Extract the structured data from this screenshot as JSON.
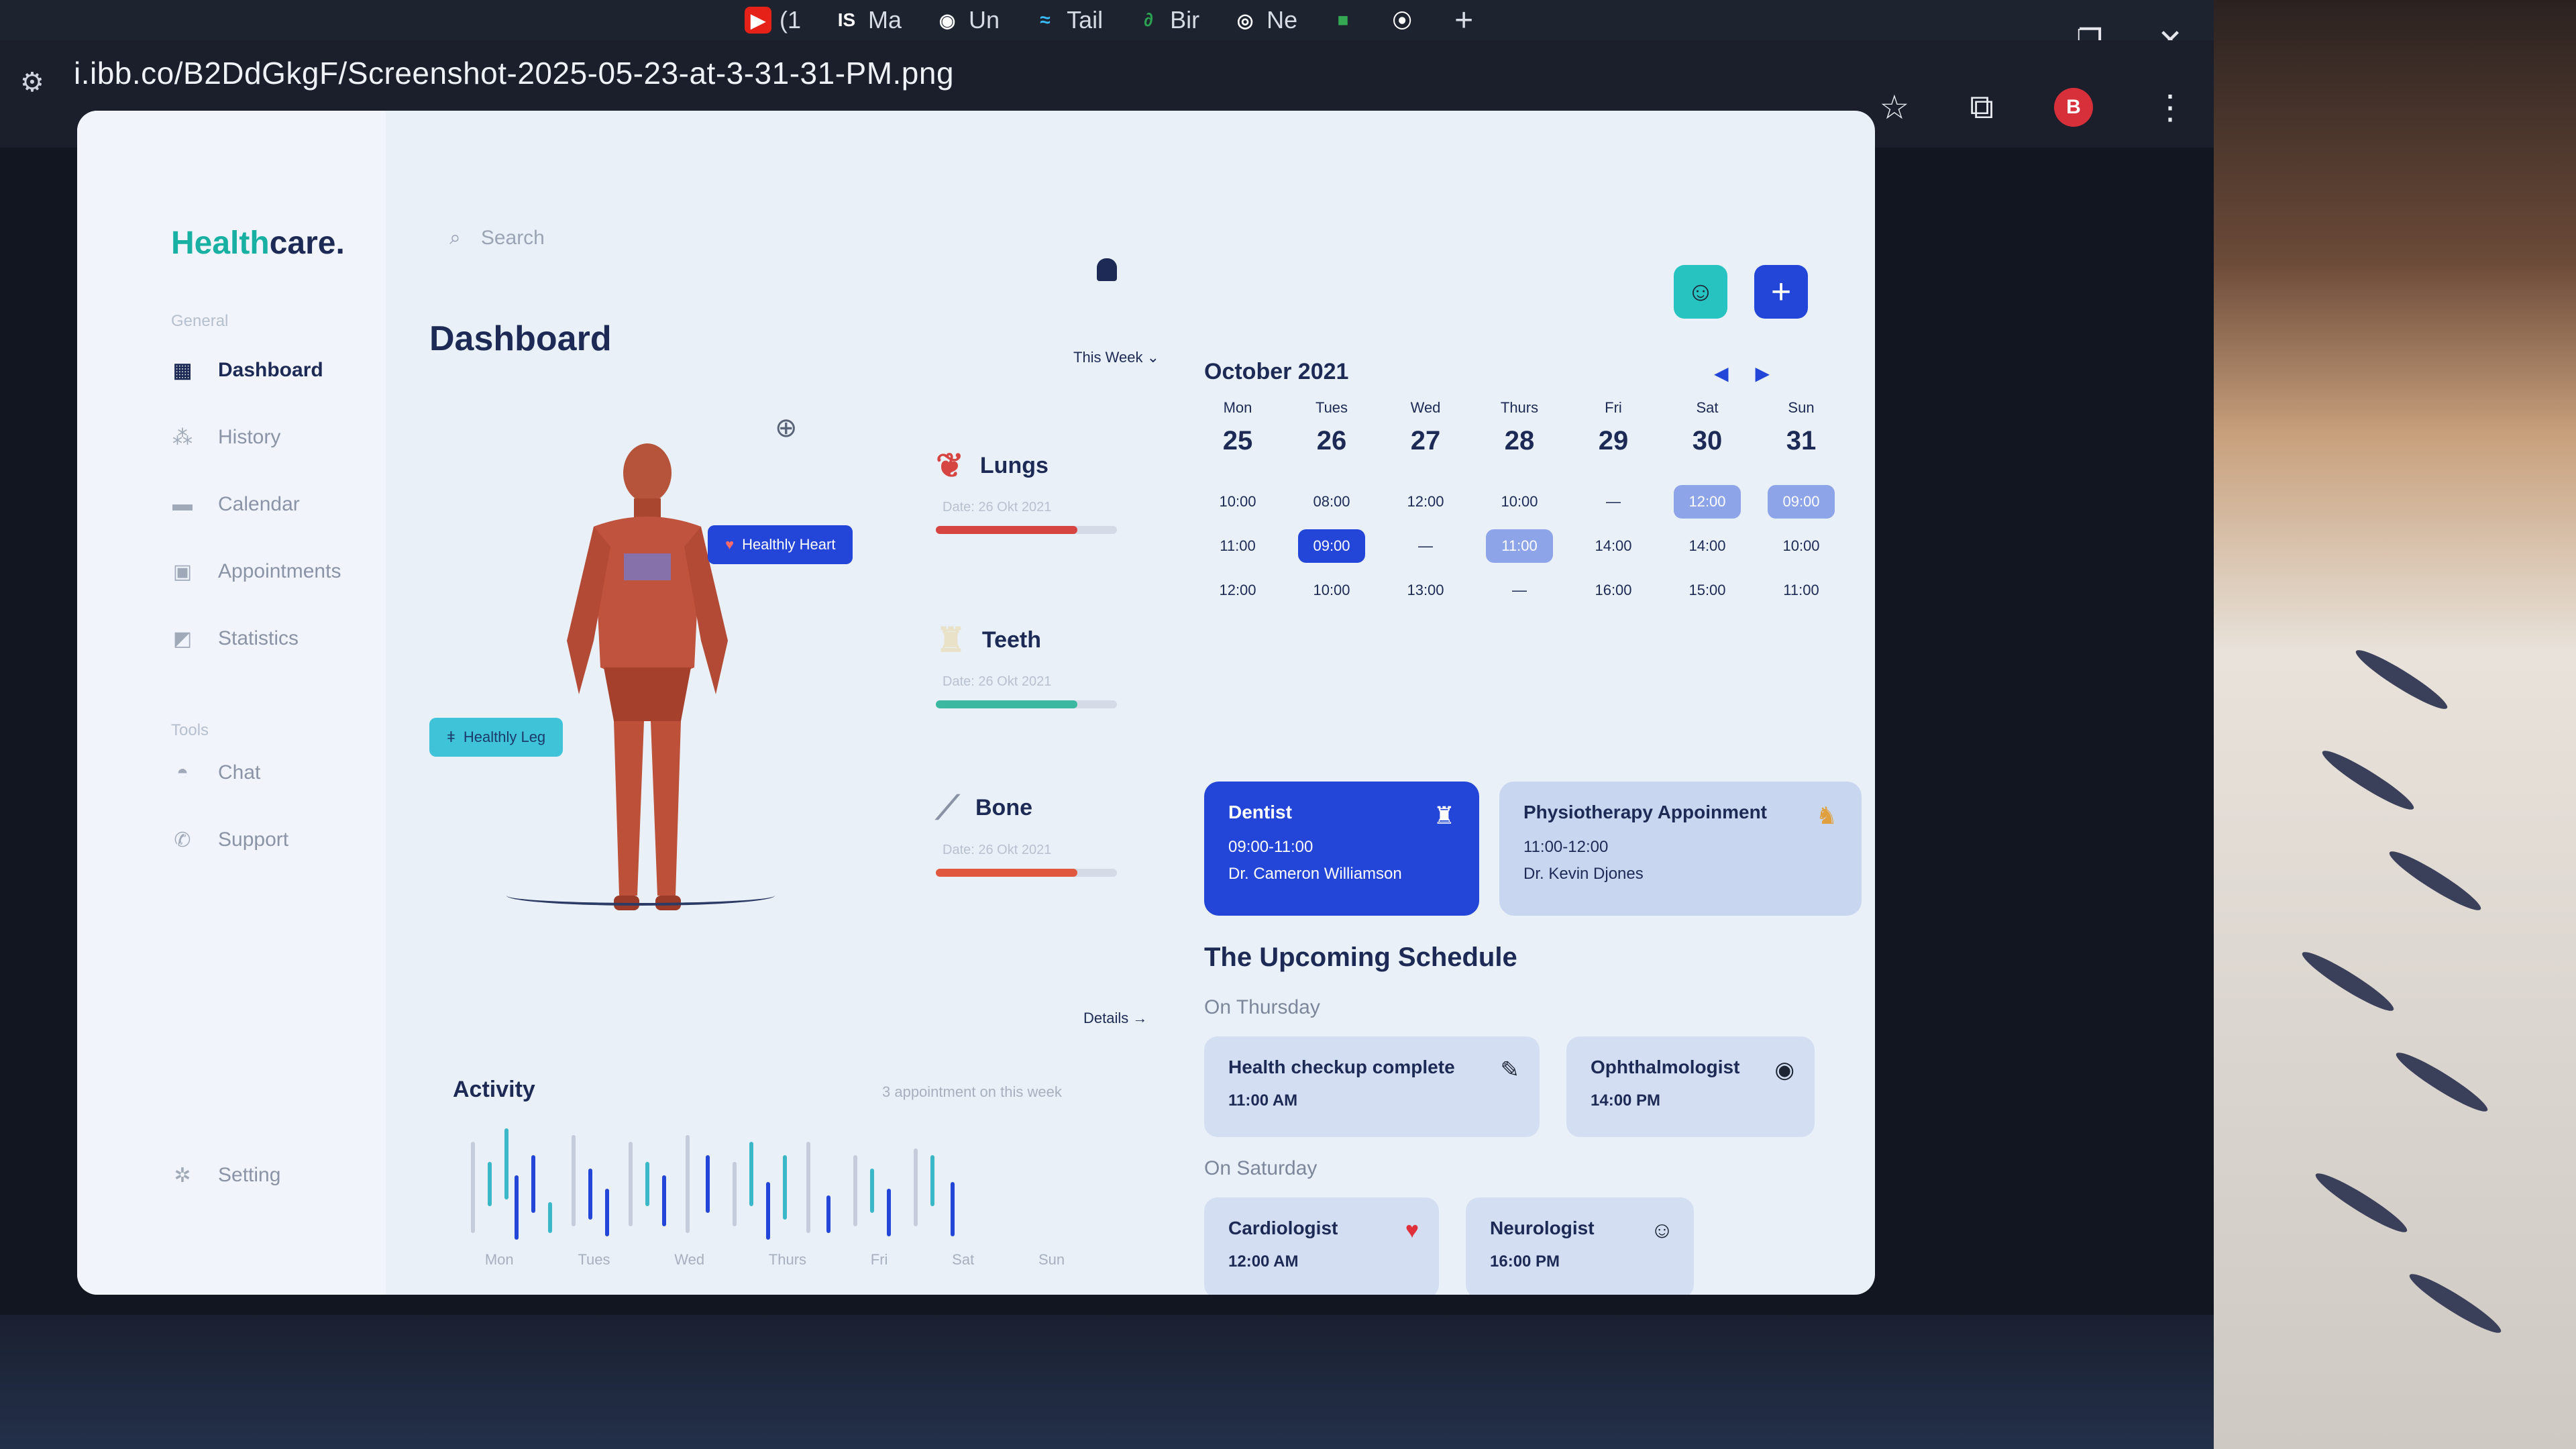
{
  "browser": {
    "tabs": [
      {
        "label": "(1",
        "icon": "youtube-icon",
        "color": "#e62117"
      },
      {
        "label": "Ma",
        "icon": "stackshare-icon",
        "color": "#222"
      },
      {
        "label": "Un",
        "icon": "github-icon",
        "color": "#222"
      },
      {
        "label": "Tail",
        "icon": "tailwind-icon",
        "color": "#38bdf8"
      },
      {
        "label": "Bir",
        "icon": "bir-icon",
        "color": "#2aa050"
      },
      {
        "label": "Ne",
        "icon": "chrome-icon",
        "color": "#888"
      }
    ],
    "url": "i.ibb.co/B2DdGkgF/Screenshot-2025-05-23-at-3-31-31-PM.png",
    "profile_initial": "B"
  },
  "app": {
    "logo_part1": "Health",
    "logo_part2": "care.",
    "section_general": "General",
    "section_tools": "Tools",
    "nav": [
      {
        "label": "Dashboard",
        "icon": "dashboard-icon",
        "active": true
      },
      {
        "label": "History",
        "icon": "history-icon"
      },
      {
        "label": "Calendar",
        "icon": "calendar-icon"
      },
      {
        "label": "Appointments",
        "icon": "appointments-icon"
      },
      {
        "label": "Statistics",
        "icon": "statistics-icon"
      }
    ],
    "tools": [
      {
        "label": "Chat",
        "icon": "chat-icon"
      },
      {
        "label": "Support",
        "icon": "phone-icon"
      }
    ],
    "setting_label": "Setting",
    "search_placeholder": "Search",
    "page_title": "Dashboard",
    "week_selector": "This Week",
    "badge_heart": "Healthly Heart",
    "badge_leg": "Healthly Leg",
    "organs": [
      {
        "name": "Lungs",
        "date": "Date: 26 Okt 2021",
        "progress": 0.78,
        "color": "#d64541"
      },
      {
        "name": "Teeth",
        "date": "Date: 26 Okt 2021",
        "progress": 0.78,
        "color": "#3bb8a0"
      },
      {
        "name": "Bone",
        "date": "Date: 26 Okt 2021",
        "progress": 0.78,
        "color": "#e0593f"
      }
    ],
    "details_link": "Details →",
    "activity_title": "Activity",
    "activity_sub": "3 appointment on this week",
    "activity_days": [
      "Mon",
      "Tues",
      "Wed",
      "Thurs",
      "Fri",
      "Sat",
      "Sun"
    ],
    "calendar": {
      "month": "October 2021",
      "days": [
        {
          "name": "Mon",
          "num": "25",
          "slots": [
            "10:00",
            "11:00",
            "12:00"
          ]
        },
        {
          "name": "Tues",
          "num": "26",
          "slots": [
            "08:00",
            "09:00",
            "10:00"
          ]
        },
        {
          "name": "Wed",
          "num": "27",
          "slots": [
            "12:00",
            "—",
            "13:00"
          ]
        },
        {
          "name": "Thurs",
          "num": "28",
          "slots": [
            "10:00",
            "11:00",
            "—"
          ]
        },
        {
          "name": "Fri",
          "num": "29",
          "slots": [
            "—",
            "14:00",
            "16:00"
          ]
        },
        {
          "name": "Sat",
          "num": "30",
          "slots": [
            "12:00",
            "14:00",
            "15:00"
          ]
        },
        {
          "name": "Sun",
          "num": "31",
          "slots": [
            "09:00",
            "10:00",
            "11:00"
          ]
        }
      ]
    },
    "appointments": [
      {
        "title": "Dentist",
        "time": "09:00-11:00",
        "doctor": "Dr. Cameron Williamson",
        "icon": "tooth-icon"
      },
      {
        "title": "Physiotherapy Appoinment",
        "time": "11:00-12:00",
        "doctor": "Dr. Kevin Djones",
        "icon": "physio-icon"
      }
    ],
    "upcoming_title": "The Upcoming Schedule",
    "on_thursday": "On Thursday",
    "on_saturday": "On Saturday",
    "schedule": [
      {
        "title": "Health checkup complete",
        "time": "11:00 AM",
        "icon": "syringe-icon"
      },
      {
        "title": "Ophthalmologist",
        "time": "14:00 PM",
        "icon": "eye-icon"
      },
      {
        "title": "Cardiologist",
        "time": "12:00 AM",
        "icon": "heart-icon"
      },
      {
        "title": "Neurologist",
        "time": "16:00 PM",
        "icon": "doctor-icon"
      }
    ]
  }
}
